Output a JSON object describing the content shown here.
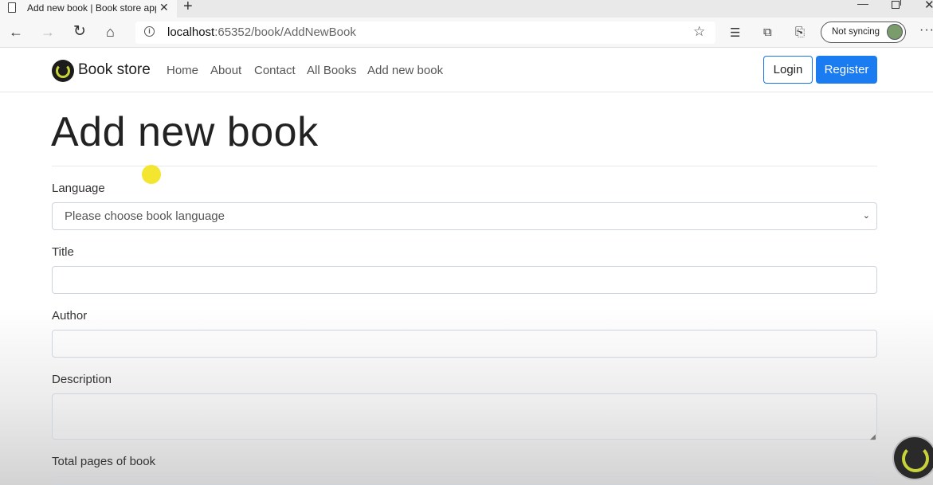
{
  "browser": {
    "tab_title": "Add new book | Book store appl",
    "url_host": "localhost",
    "url_path": ":65352/book/AddNewBook",
    "sync_label": "Not syncing"
  },
  "site": {
    "brand": "Book store",
    "nav": [
      "Home",
      "About",
      "Contact",
      "All Books",
      "Add new book"
    ],
    "login_label": "Login",
    "register_label": "Register",
    "accent_color": "#1a7cf0"
  },
  "form": {
    "page_title": "Add new book",
    "language_label": "Language",
    "language_selected": "Please choose book language",
    "title_label": "Title",
    "author_label": "Author",
    "description_label": "Description",
    "pages_label": "Total pages of book"
  }
}
